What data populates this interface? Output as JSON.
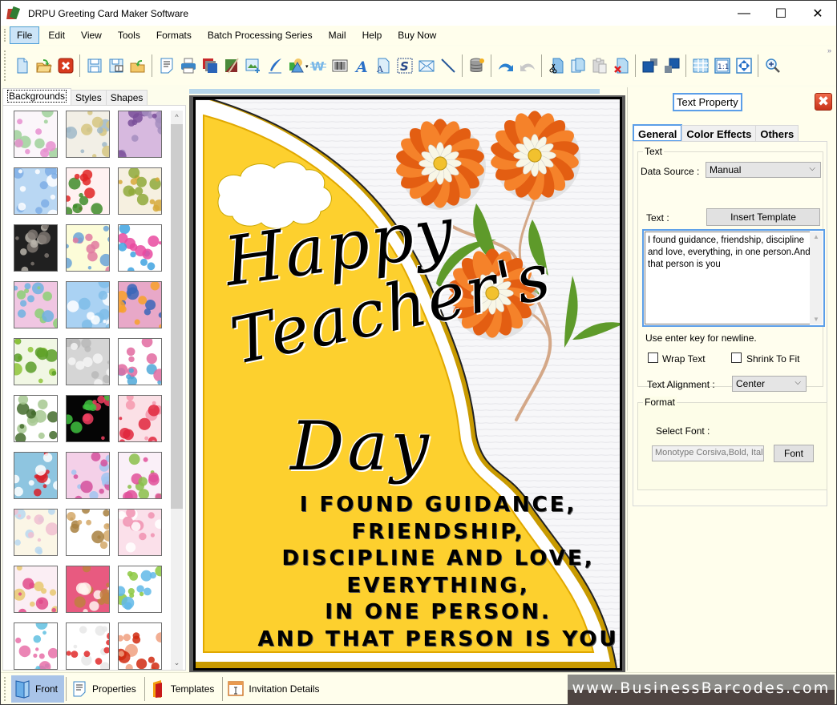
{
  "window": {
    "title": "DRPU Greeting Card Maker Software",
    "controls": {
      "minimize": "—",
      "maximize": "☐",
      "close": "✕"
    }
  },
  "menubar": {
    "items": [
      {
        "label": "File",
        "active": true
      },
      {
        "label": "Edit"
      },
      {
        "label": "View"
      },
      {
        "label": "Tools"
      },
      {
        "label": "Formats"
      },
      {
        "label": "Batch Processing Series"
      },
      {
        "label": "Mail"
      },
      {
        "label": "Help"
      },
      {
        "label": "Buy Now"
      }
    ]
  },
  "toolbar": {
    "overflow": "»",
    "groups": [
      [
        "new-icon",
        "open-icon",
        "close-file-icon"
      ],
      [
        "save-icon",
        "save-as-icon",
        "export-icon"
      ],
      [
        "properties-icon",
        "print-icon",
        "background-icon",
        "color-fill-icon",
        "insert-image-icon",
        "pen-icon",
        "shapes-icon",
        "watermark-icon",
        "barcode-icon",
        "text-icon",
        "text-box-icon",
        "signature-icon",
        "mail-icon",
        "line-icon"
      ],
      [
        "database-icon"
      ],
      [
        "undo-icon",
        "redo-icon"
      ],
      [
        "cut-icon",
        "copy-icon",
        "paste-icon",
        "delete-icon"
      ],
      [
        "bring-front-icon",
        "send-back-icon"
      ],
      [
        "grid-icon",
        "actual-size-icon",
        "fit-to-window-icon"
      ],
      [
        "zoom-in-icon"
      ]
    ]
  },
  "left_panel": {
    "tabs": [
      {
        "label": "Backgrounds",
        "active": true
      },
      {
        "label": "Styles"
      },
      {
        "label": "Shapes"
      }
    ],
    "thumbnails": [
      {
        "name": "baby-shower",
        "colors": [
          "#fbf6fa",
          "#e68fcf",
          "#9fd19a"
        ]
      },
      {
        "name": "baby-toys",
        "colors": [
          "#f2efe6",
          "#d6c680",
          "#a0b8c8"
        ]
      },
      {
        "name": "purple-flowers",
        "colors": [
          "#d7b9df",
          "#7a4f9a",
          "#a48dc0"
        ]
      },
      {
        "name": "blue-sky-clouds",
        "colors": [
          "#b9d7f3",
          "#ffffff",
          "#7eaee5"
        ]
      },
      {
        "name": "strawberries",
        "colors": [
          "#fff1f1",
          "#e02424",
          "#3f8c2a"
        ]
      },
      {
        "name": "autumn-leaves",
        "colors": [
          "#f6f0e0",
          "#d6a93a",
          "#8fa93a"
        ]
      },
      {
        "name": "grey-roses",
        "colors": [
          "#202020",
          "#b8b4aa",
          "#7c7670"
        ]
      },
      {
        "name": "tiny-flowers",
        "colors": [
          "#fcfcd8",
          "#e07aa0",
          "#6aa3d8"
        ]
      },
      {
        "name": "gift-boxes",
        "colors": [
          "#ffffff",
          "#e94aa0",
          "#3fa3e0"
        ]
      },
      {
        "name": "floral-circles",
        "colors": [
          "#f0c6e2",
          "#6fb1e0",
          "#8ccf76"
        ]
      },
      {
        "name": "snowflakes",
        "colors": [
          "#aad2f3",
          "#ffffff",
          "#7fbde8"
        ]
      },
      {
        "name": "mandala-circles",
        "colors": [
          "#e8a8c8",
          "#f7a12a",
          "#3a66b8"
        ]
      },
      {
        "name": "christmas-trees",
        "colors": [
          "#f1f7e4",
          "#8fc63a",
          "#5a9e28"
        ]
      },
      {
        "name": "white-heart",
        "colors": [
          "#d5d5d5",
          "#f5f5f5",
          "#b9b9b9"
        ]
      },
      {
        "name": "kids-doodles",
        "colors": [
          "#ffffff",
          "#e26aa0",
          "#4fa8d8"
        ]
      },
      {
        "name": "green-ornaments",
        "colors": [
          "#ffffff",
          "#436b2c",
          "#a6c890"
        ]
      },
      {
        "name": "fireworks",
        "colors": [
          "#050505",
          "#f04060",
          "#40c040"
        ]
      },
      {
        "name": "red-hearts",
        "colors": [
          "#fbe0e6",
          "#e0263c",
          "#f598ad"
        ]
      },
      {
        "name": "santa-pattern",
        "colors": [
          "#8ec5e0",
          "#d8202a",
          "#ffffff"
        ]
      },
      {
        "name": "pink-bubbles",
        "colors": [
          "#f4d0e8",
          "#d4509c",
          "#a0c4f0"
        ]
      },
      {
        "name": "pink-lilies",
        "colors": [
          "#faf0f8",
          "#e0509a",
          "#8ac04a"
        ]
      },
      {
        "name": "pastel-stripes",
        "colors": [
          "#fbf6e6",
          "#f0c0d0",
          "#b8d8f0"
        ]
      },
      {
        "name": "teddy-bear",
        "colors": [
          "#ffffff",
          "#d4a868",
          "#a88040"
        ]
      },
      {
        "name": "pink-dress",
        "colors": [
          "#fbe0ea",
          "#f090b0",
          "#ffffff"
        ]
      },
      {
        "name": "pink-hearts-butterflies",
        "colors": [
          "#fbeef4",
          "#e04a8a",
          "#e8c870"
        ]
      },
      {
        "name": "heart-teddy",
        "colors": [
          "#e85a80",
          "#fff6f0",
          "#c08040"
        ]
      },
      {
        "name": "easter-bunnies",
        "colors": [
          "#ffffff",
          "#8cc840",
          "#60b8e8"
        ]
      },
      {
        "name": "kids-rainbow",
        "colors": [
          "#ffffff",
          "#e870a8",
          "#60c0e0"
        ]
      },
      {
        "name": "hearts-ribbons",
        "colors": [
          "#ffffff",
          "#e02a2a",
          "#e8e8e8"
        ]
      },
      {
        "name": "red-flower",
        "colors": [
          "#ffffff",
          "#d02a10",
          "#f0a080"
        ]
      }
    ],
    "scroll": {
      "up": "^",
      "down": "⌄"
    }
  },
  "card": {
    "title_lines": [
      "Happy",
      "Teacher's",
      "Day"
    ],
    "message_lines": [
      "I FOUND GUIDANCE,",
      "FRIENDSHIP,",
      "DISCIPLINE AND LOVE,",
      "EVERYTHING,",
      "IN ONE PERSON.",
      "AND THAT PERSON IS YOU"
    ],
    "colors": {
      "panel": "#fdd02e",
      "panel_edge": "#e0a800",
      "petal": "#f5822a",
      "petal_dark": "#e35e12",
      "daisy": "#f8f6e6",
      "center": "#f2c12e",
      "leaf": "#5e9a2a",
      "stem": "#d4a888"
    }
  },
  "right_panel": {
    "title": "Text Property",
    "close": "✖",
    "tabs": [
      {
        "label": "General",
        "active": true
      },
      {
        "label": "Color Effects"
      },
      {
        "label": "Others"
      }
    ],
    "text_group": {
      "legend": "Text",
      "data_source_label": "Data Source :",
      "data_source_value": "Manual",
      "text_label": "Text :",
      "insert_template_button": "Insert Template",
      "text_value": "I found guidance, friendship, discipline and love, everything, in one person.And that person is you",
      "hint": "Use enter key for newline.",
      "wrap_text_label": "Wrap Text",
      "wrap_text_checked": false,
      "shrink_to_fit_label": "Shrink To Fit",
      "shrink_to_fit_checked": false,
      "alignment_label": "Text Alignment :",
      "alignment_value": "Center"
    },
    "format_group": {
      "legend": "Format",
      "select_font_label": "Select Font :",
      "font_value": "Monotype Corsiva,Bold, Italic",
      "font_button": "Font"
    }
  },
  "bottom_bar": {
    "items": [
      {
        "label": "Front",
        "active": true
      },
      {
        "label": "Properties"
      },
      {
        "label": "Templates"
      },
      {
        "label": "Invitation Details"
      }
    ],
    "brand": "www.BusinessBarcodes.com"
  }
}
